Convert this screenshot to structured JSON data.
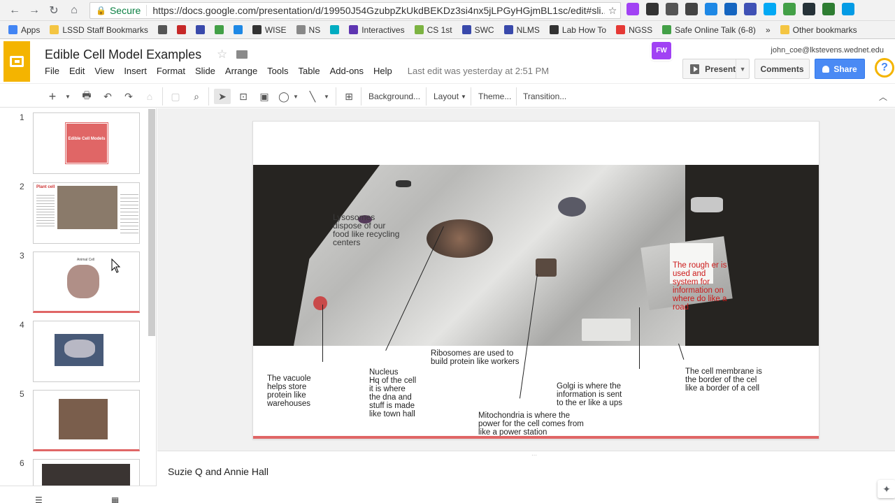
{
  "browser": {
    "secure_label": "Secure",
    "url": "https://docs.google.com/presentation/d/19950J54GzubpZkUkdBEKDz3si4nx5jLPGyHGjmBL1sc/edit#sli...",
    "bookmarks": [
      {
        "label": "Apps",
        "icon": "apps-grid-icon",
        "color": "#4285f4"
      },
      {
        "label": "LSSD Staff Bookmarks",
        "icon": "folder-icon",
        "color": "#f4c542"
      },
      {
        "label": "",
        "icon": "star-icon",
        "color": "#555555"
      },
      {
        "label": "",
        "icon": "shield-icon",
        "color": "#c62828"
      },
      {
        "label": "",
        "icon": "calendar-icon",
        "color": "#3949ab"
      },
      {
        "label": "",
        "icon": "px-icon",
        "color": "#43a047"
      },
      {
        "label": "",
        "icon": "image-icon",
        "color": "#1e88e5"
      },
      {
        "label": "WISE",
        "icon": "paw-icon",
        "color": "#333333"
      },
      {
        "label": "NS",
        "icon": "page-icon",
        "color": "#888888"
      },
      {
        "label": "",
        "icon": "play-icon",
        "color": "#00acc1"
      },
      {
        "label": "Interactives",
        "icon": "uen-icon",
        "color": "#5e35b1"
      },
      {
        "label": "CS 1st",
        "icon": "flag-icon",
        "color": "#7cb342"
      },
      {
        "label": "SWC",
        "icon": "calendar-icon",
        "color": "#3949ab"
      },
      {
        "label": "NLMS",
        "icon": "calendar-icon",
        "color": "#3949ab"
      },
      {
        "label": "Lab How To",
        "icon": "clip-icon",
        "color": "#333333"
      },
      {
        "label": "NGSS",
        "icon": "circle-icon",
        "color": "#e53935"
      },
      {
        "label": "Safe Online Talk (6-8)",
        "icon": "check-icon",
        "color": "#43a047"
      },
      {
        "label": "»",
        "icon": "",
        "color": ""
      },
      {
        "label": "Other bookmarks",
        "icon": "folder-icon",
        "color": "#f4c542"
      }
    ]
  },
  "app": {
    "title": "Edible Cell Model Examples",
    "user_email": "john_coe@lkstevens.wednet.edu",
    "menu": [
      "File",
      "Edit",
      "View",
      "Insert",
      "Format",
      "Slide",
      "Arrange",
      "Tools",
      "Table",
      "Add-ons",
      "Help"
    ],
    "last_edit": "Last edit was yesterday at 2:51 PM",
    "present_label": "Present",
    "comments_label": "Comments",
    "share_label": "Share",
    "fw_badge": "FW",
    "accent_color": "#f4b400",
    "share_color": "#4a8af4"
  },
  "toolbar": {
    "background_label": "Background...",
    "layout_label": "Layout",
    "theme_label": "Theme...",
    "transition_label": "Transition..."
  },
  "filmstrip": {
    "slides": [
      {
        "number": "1",
        "caption": "Edible Cell Models"
      },
      {
        "number": "2",
        "caption": "Plant cell"
      },
      {
        "number": "3",
        "caption": "Animal Cell"
      },
      {
        "number": "4",
        "caption": ""
      },
      {
        "number": "5",
        "caption": ""
      },
      {
        "number": "6",
        "caption": ""
      }
    ]
  },
  "slide": {
    "labels": {
      "lysosomes": "Lysosomes\ndispose of our\nfood like recycling\ncenters",
      "rough_er": "The rough er is\nused and\nsystem for\ninformation on\nwhere do like a\nroad",
      "ribosomes": "Ribosomes are used to\nbuild protein like workers",
      "vacuole": "The vacuole\nhelps store\nprotein like\nwarehouses",
      "nucleus": "Nucleus\nHq of the cell\nit is where\nthe dna and\nstuff is made\nlike town hall",
      "golgi": "Golgi is where the\ninformation is sent\nto the er like a ups",
      "membrane": "The cell membrane is\nthe border of the cel\nlike a border of a cell",
      "mitochondria": "Mitochondria is where the\npower for the cell comes from\nlike a power station"
    },
    "accent_bar_color": "#e06666"
  },
  "notes": {
    "text": "Suzie Q and Annie Hall"
  }
}
